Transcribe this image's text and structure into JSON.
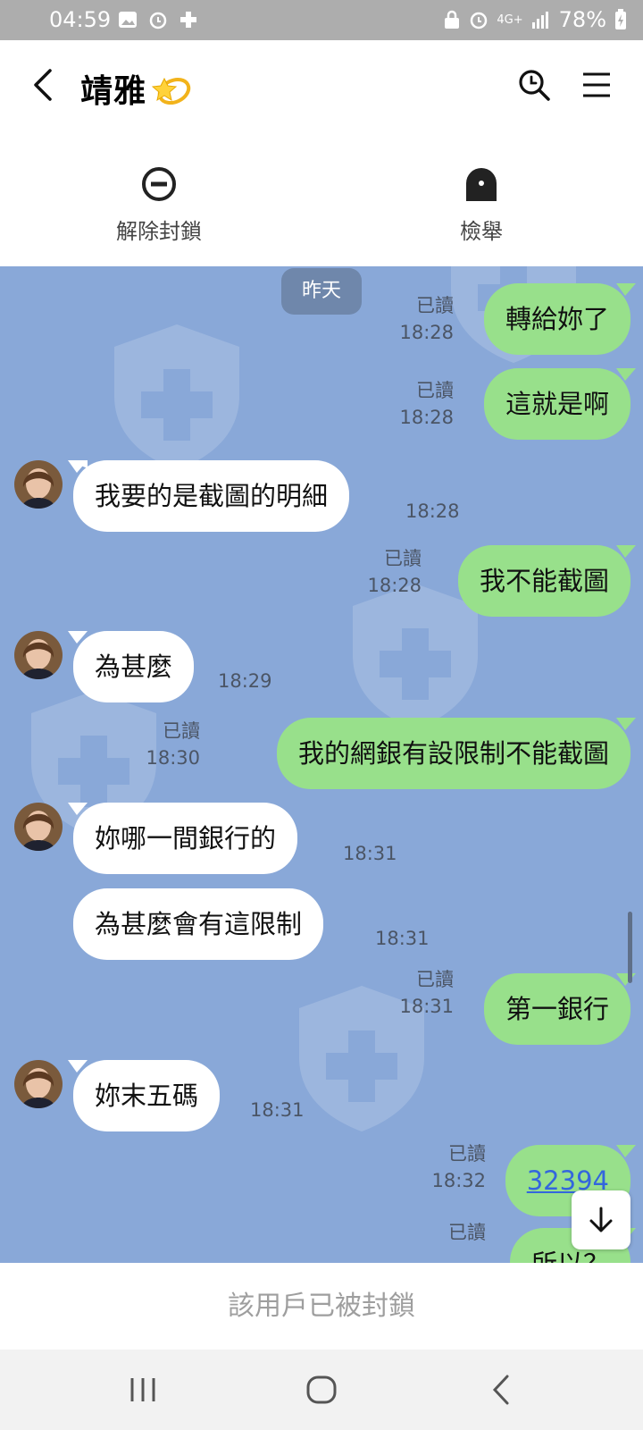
{
  "status_bar": {
    "time": "04:59",
    "network": "4G+",
    "battery": "78%",
    "left_icons": [
      "gallery-icon",
      "alarm-icon",
      "game-icon"
    ],
    "right_icons": [
      "lock-icon",
      "alarm-icon",
      "signal-icon",
      "battery-charging-icon"
    ]
  },
  "header": {
    "title": "靖雅",
    "title_emoji": "dizzy-star-emoji",
    "actions": [
      {
        "label": "解除封鎖",
        "icon": "unblock-icon"
      },
      {
        "label": "檢舉",
        "icon": "report-icon"
      }
    ]
  },
  "chat": {
    "date_separator": "昨天",
    "read_label": "已讀",
    "messages": [
      {
        "side": "out",
        "text": "轉給妳了",
        "time": "18:28",
        "read": true
      },
      {
        "side": "out",
        "text": "這就是啊",
        "time": "18:28",
        "read": true
      },
      {
        "side": "in",
        "text": "我要的是截圖的明細",
        "time": "18:28"
      },
      {
        "side": "out",
        "text": "我不能截圖",
        "time": "18:28",
        "read": true
      },
      {
        "side": "in",
        "text": "為甚麼",
        "time": "18:29"
      },
      {
        "side": "out",
        "text": "我的網銀有設限制不能截圖",
        "time": "18:30",
        "read": true
      },
      {
        "side": "in",
        "text": "妳哪一間銀行的",
        "time": "18:31"
      },
      {
        "side": "in",
        "text": "為甚麼會有這限制",
        "time": "18:31"
      },
      {
        "side": "out",
        "text": "第一銀行",
        "time": "18:31",
        "read": true
      },
      {
        "side": "in",
        "text": "妳末五碼",
        "time": "18:31"
      },
      {
        "side": "out",
        "text": "32394",
        "time": "18:32",
        "read": true,
        "link": true
      },
      {
        "side": "out",
        "text": "所以？",
        "time": "",
        "read": true
      }
    ]
  },
  "scroll_down_icon": "arrow-down-icon",
  "blocked_notice": "該用戶已被封鎖",
  "nav": [
    "recents-icon",
    "home-icon",
    "back-icon"
  ],
  "colors": {
    "chat_bg": "#89a8d8",
    "outgoing_bubble": "#98e08b",
    "incoming_bubble": "#ffffff",
    "date_pill": "#6f87ab",
    "status_bar": "#adadad"
  }
}
